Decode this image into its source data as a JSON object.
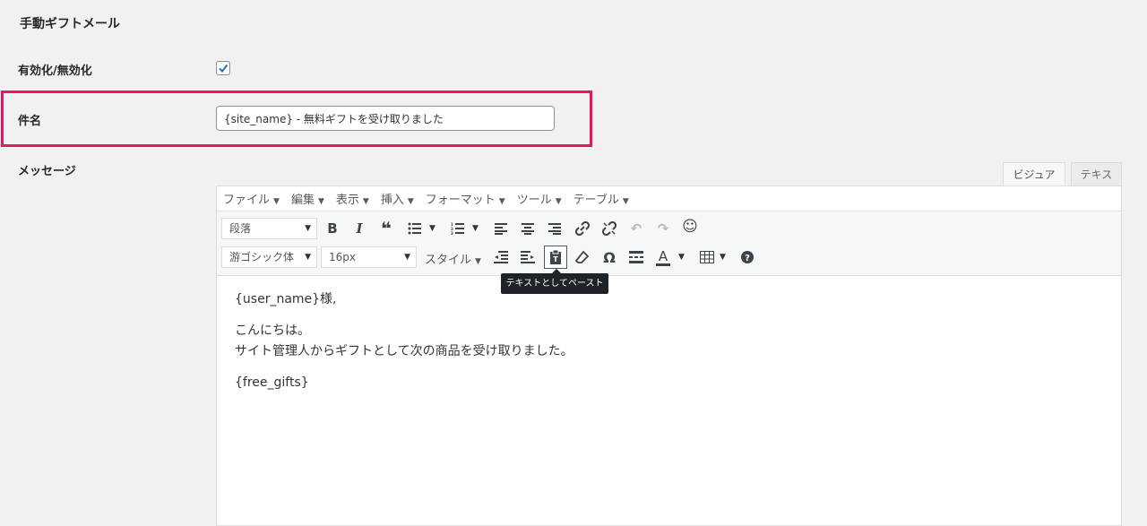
{
  "section_title": "手動ギフトメール",
  "enable": {
    "label": "有効化/無効化",
    "checked": true
  },
  "subject": {
    "label": "件名",
    "value": "{site_name} - 無料ギフトを受け取りました"
  },
  "message": {
    "label": "メッセージ"
  },
  "editor": {
    "tabs": {
      "visual": "ビジュアル",
      "text": "テキスト"
    },
    "menus": [
      "ファイル",
      "編集",
      "表示",
      "挿入",
      "フォーマット",
      "ツール",
      "テーブル"
    ],
    "format_select": "段落",
    "font_family_select": "游ゴシック体",
    "font_size_select": "16px",
    "style_menu": "スタイル",
    "tooltip": "テキストとしてペースト",
    "content": {
      "greeting": "{user_name}様,",
      "line1": "こんにちは。",
      "line2": "サイト管理人からギフトとして次の商品を受け取りました。",
      "placeholder": "{free_gifts}"
    }
  },
  "colors": {
    "highlight": "#ec145a",
    "checkbox": "#2271b1"
  }
}
